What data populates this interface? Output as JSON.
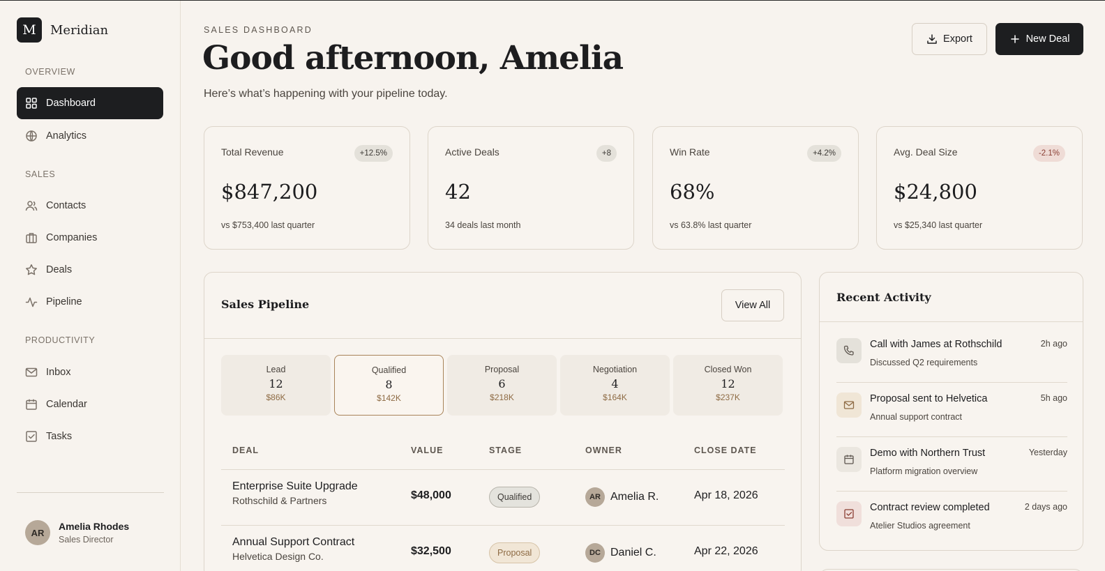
{
  "brand": {
    "mark": "M",
    "name": "Meridian"
  },
  "sidebar": {
    "sections": [
      {
        "label": "OVERVIEW",
        "items": [
          {
            "label": "Dashboard",
            "icon": "grid-icon",
            "active": true
          },
          {
            "label": "Analytics",
            "icon": "globe-icon"
          }
        ]
      },
      {
        "label": "SALES",
        "items": [
          {
            "label": "Contacts",
            "icon": "users-icon"
          },
          {
            "label": "Companies",
            "icon": "briefcase-icon"
          },
          {
            "label": "Deals",
            "icon": "star-icon"
          },
          {
            "label": "Pipeline",
            "icon": "activity-icon"
          }
        ]
      },
      {
        "label": "PRODUCTIVITY",
        "items": [
          {
            "label": "Inbox",
            "icon": "mail-icon"
          },
          {
            "label": "Calendar",
            "icon": "calendar-icon"
          },
          {
            "label": "Tasks",
            "icon": "check-square-icon"
          }
        ]
      }
    ],
    "user": {
      "initials": "AR",
      "name": "Amelia Rhodes",
      "role": "Sales Director"
    }
  },
  "header": {
    "eyebrow": "SALES DASHBOARD",
    "greeting": "Good afternoon, Amelia",
    "subtitle": "Here’s what’s happening with your pipeline today.",
    "export_label": "Export",
    "new_deal_label": "New Deal"
  },
  "kpis": [
    {
      "label": "Total Revenue",
      "badge": "+12.5%",
      "value": "$847,200",
      "note": "vs $753,400 last quarter"
    },
    {
      "label": "Active Deals",
      "badge": "+8",
      "value": "42",
      "note": "34 deals last month"
    },
    {
      "label": "Win Rate",
      "badge": "+4.2%",
      "value": "68%",
      "note": "vs 63.8% last quarter"
    },
    {
      "label": "Avg. Deal Size",
      "badge": "-2.1%",
      "value": "$24,800",
      "note": "vs $25,340 last quarter"
    }
  ],
  "pipeline": {
    "title": "Sales Pipeline",
    "view_all_label": "View All",
    "stages": [
      {
        "name": "Lead",
        "count": "12",
        "value": "$86K"
      },
      {
        "name": "Qualified",
        "count": "8",
        "value": "$142K",
        "selected": true
      },
      {
        "name": "Proposal",
        "count": "6",
        "value": "$218K"
      },
      {
        "name": "Negotiation",
        "count": "4",
        "value": "$164K"
      },
      {
        "name": "Closed Won",
        "count": "12",
        "value": "$237K"
      }
    ],
    "columns": [
      "DEAL",
      "VALUE",
      "STAGE",
      "OWNER",
      "CLOSE DATE"
    ],
    "rows": [
      {
        "deal": "Enterprise Suite Upgrade",
        "company": "Rothschild & Partners",
        "value": "$48,000",
        "stage": "Qualified",
        "owner_initials": "AR",
        "owner": "Amelia R.",
        "close": "Apr 18, 2026"
      },
      {
        "deal": "Annual Support Contract",
        "company": "Helvetica Design Co.",
        "value": "$32,500",
        "stage": "Proposal",
        "owner_initials": "DC",
        "owner": "Daniel C.",
        "close": "Apr 22, 2026"
      }
    ]
  },
  "activity": {
    "title": "Recent Activity",
    "items": [
      {
        "icon": "phone-icon",
        "title": "Call with James at Rothschild",
        "sub": "Discussed Q2 requirements",
        "time": "2h ago"
      },
      {
        "icon": "mail-icon",
        "title": "Proposal sent to Helvetica",
        "sub": "Annual support contract",
        "time": "5h ago"
      },
      {
        "icon": "calendar-icon",
        "title": "Demo with Northern Trust",
        "sub": "Platform migration overview",
        "time": "Yesterday"
      },
      {
        "icon": "check-square-icon",
        "title": "Contract review completed",
        "sub": "Atelier Studios agreement",
        "time": "2 days ago"
      }
    ]
  },
  "colors": {
    "accent": "#1d1e20",
    "background": "#f7f3ee",
    "gold": "#8e6b44",
    "negative": "#8a3d32"
  }
}
